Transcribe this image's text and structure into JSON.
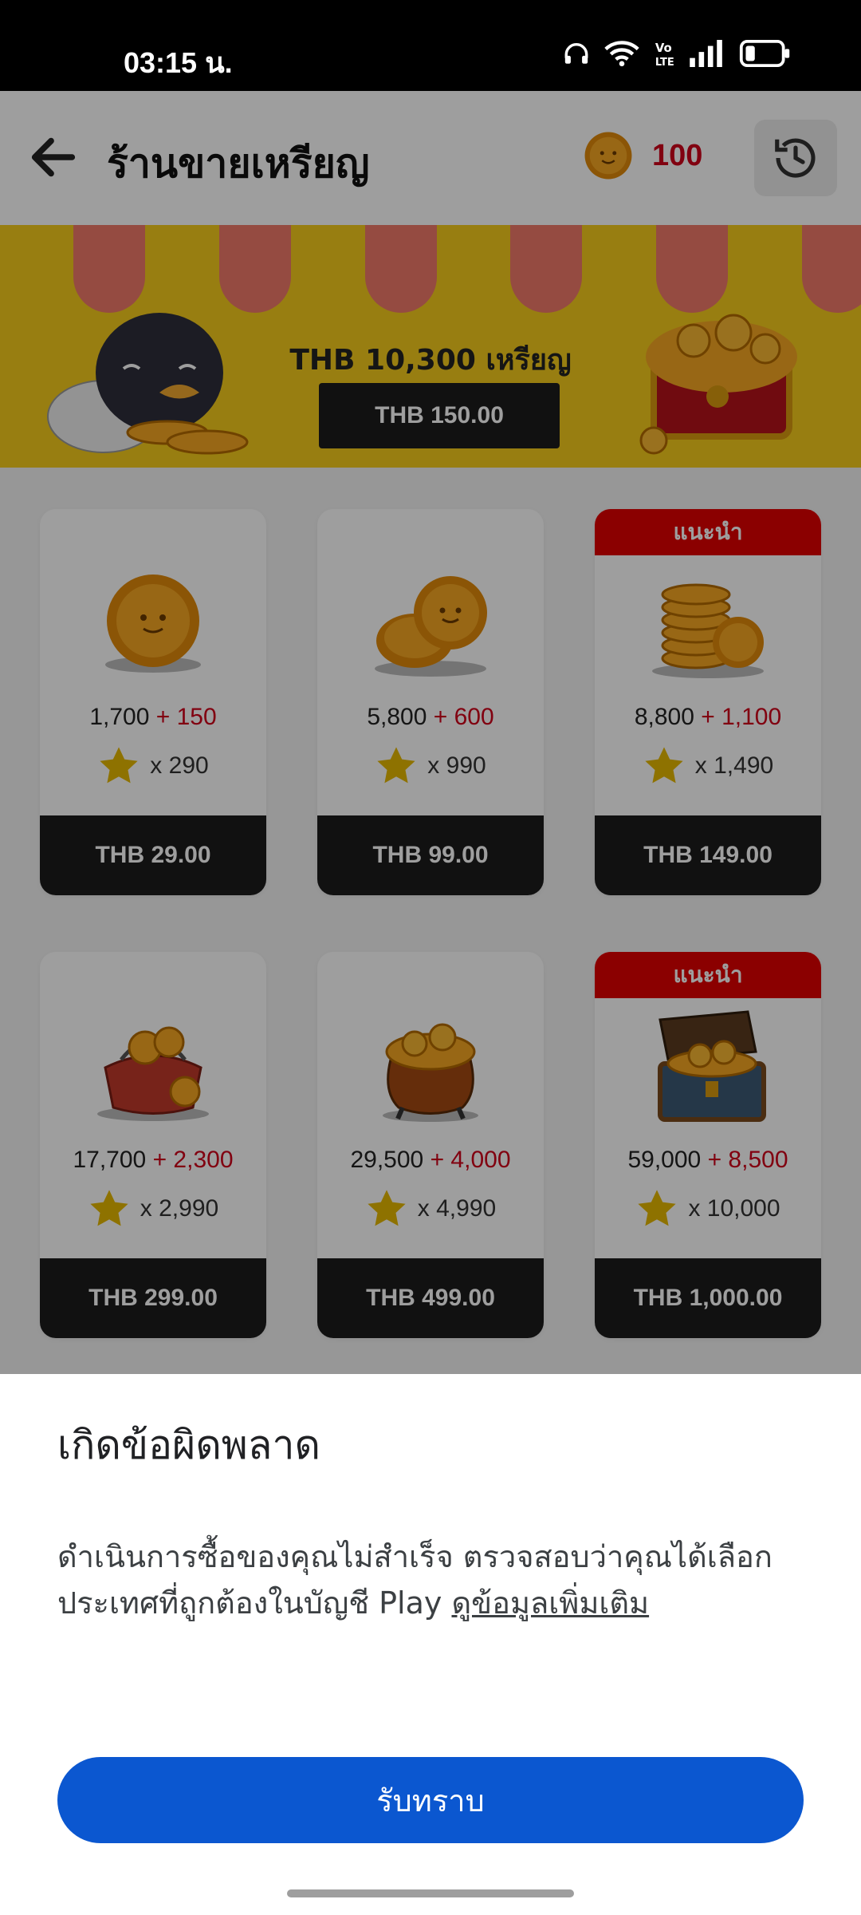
{
  "status_bar": {
    "time": "03:15 น.",
    "icons": [
      "headphones-icon",
      "wifi-icon",
      "volte-icon",
      "signal-icon",
      "battery-icon"
    ]
  },
  "header": {
    "title": "ร้านขายเหรียญ",
    "coin_balance": "100",
    "back_icon": "arrow-left-icon",
    "history_icon": "history-icon"
  },
  "banner": {
    "text": "THB 10,300 เหรียญ",
    "button_label": "THB 150.00"
  },
  "products": [
    {
      "coins": "1,700",
      "bonus": "+ 150",
      "stars": "x 290",
      "price": "THB 29.00",
      "ribbon": ""
    },
    {
      "coins": "5,800",
      "bonus": "+ 600",
      "stars": "x 990",
      "price": "THB 99.00",
      "ribbon": ""
    },
    {
      "coins": "8,800",
      "bonus": "+ 1,100",
      "stars": "x 1,490",
      "price": "THB 149.00",
      "ribbon": "แนะนำ"
    },
    {
      "coins": "17,700",
      "bonus": "+ 2,300",
      "stars": "x 2,990",
      "price": "THB 299.00",
      "ribbon": ""
    },
    {
      "coins": "29,500",
      "bonus": "+ 4,000",
      "stars": "x 4,990",
      "price": "THB 499.00",
      "ribbon": ""
    },
    {
      "coins": "59,000",
      "bonus": "+ 8,500",
      "stars": "x 10,000",
      "price": "THB 1,000.00",
      "ribbon": "แนะนำ"
    }
  ],
  "dialog": {
    "title": "เกิดข้อผิดพลาด",
    "body": "ดำเนินการซื้อของคุณไม่สำเร็จ ตรวจสอบว่าคุณได้เลือกประเทศที่ถูกต้องในบัญชี Play",
    "link": "ดูข้อมูลเพิ่มเติม",
    "button": "รับทราบ"
  },
  "colors": {
    "accent_blue": "#0b57d0",
    "bonus_red": "#d0021b",
    "banner_yellow": "#f5cc1c",
    "ribbon_red": "#e00000"
  }
}
